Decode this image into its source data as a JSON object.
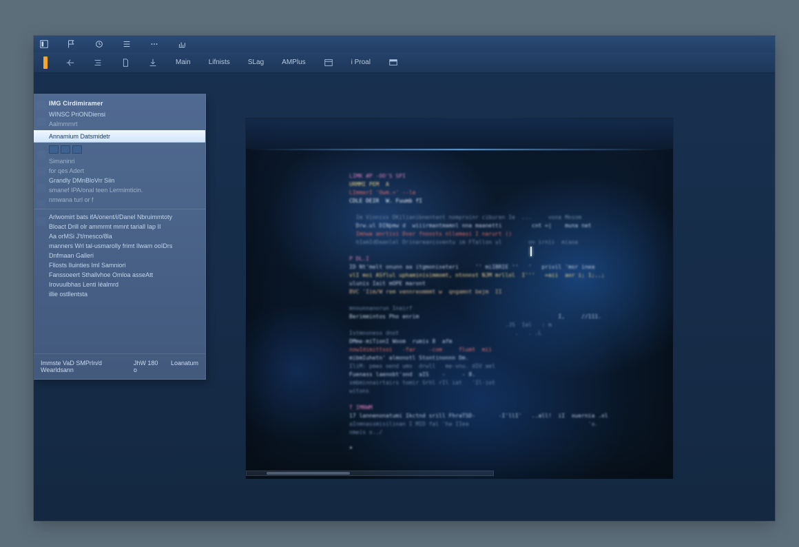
{
  "menu": {
    "items": [
      {
        "name": "app-menu-icon"
      },
      {
        "name": "flag-icon"
      },
      {
        "name": "history-icon"
      },
      {
        "name": "list-icon"
      },
      {
        "name": "more-icon"
      },
      {
        "name": "chart-icon"
      }
    ]
  },
  "toolbar": {
    "items": [
      {
        "label": "",
        "name": "orange-handle"
      },
      {
        "label": "",
        "name": "align-icon"
      },
      {
        "label": "",
        "name": "settings-icon"
      },
      {
        "label": "",
        "name": "file-icon"
      },
      {
        "label": "",
        "name": "download-icon"
      },
      {
        "label": "Main",
        "name": "tab-main"
      },
      {
        "label": "Lifnists",
        "name": "tab-lifnists"
      },
      {
        "label": "SLag",
        "name": "tab-slag"
      },
      {
        "label": "AMPlus",
        "name": "tab-amplus"
      },
      {
        "label": "",
        "name": "calendar-icon"
      },
      {
        "label": "i Proal",
        "name": "tab-iproal"
      },
      {
        "label": "",
        "name": "window-icon"
      }
    ]
  },
  "sidebar": {
    "heading1": "IMG   Cirdimiramer",
    "items": [
      {
        "label": "WINSC  PriONDiensi",
        "muted": false
      },
      {
        "label": "Aalmmrnrt",
        "muted": true
      },
      {
        "label": "Annamium Datsmidetr",
        "muted": false,
        "selected": true
      },
      {
        "label": "",
        "thumbs": true
      },
      {
        "label": "Simaninri",
        "muted": true
      },
      {
        "label": "for qes Adert",
        "muted": true
      },
      {
        "label": "Grandly DMnBloVrr Siin",
        "muted": false
      },
      {
        "label": "smanef IPA/onal teen Lermimticin.",
        "muted": true
      },
      {
        "label": "nmwana turl or f",
        "muted": true
      }
    ],
    "group2": [
      {
        "label": "Arlwomirt bats ifA/onent/i/Danel Nbruimmtoty"
      },
      {
        "label": "Bloact Drill olr ammrmt  mmnt tariall Iap II"
      },
      {
        "label": "Aa orMSi  J't/mesco/8la"
      },
      {
        "label": "manners Wrl tal-usmarolly frimt Ilwam ooIDrs"
      },
      {
        "label": "Dnfmaan Galleri"
      },
      {
        "label": "Fllosts Iluinties Iml Samniori"
      },
      {
        "label": "Fanssoeert Sthallvhoe Omloa asseAtt"
      },
      {
        "label": "Irovuulbhas Lenti Iéalmrd"
      },
      {
        "label": "illie  ostllentsta"
      }
    ],
    "footer_left": "Immste  VaD SMPrIn/d  Wearldsann",
    "footer_mid": "JhW 180 o",
    "footer_right": "Loanatum"
  },
  "code_lines": [
    {
      "t": "LIMK #P -OO'S SPI",
      "c": "kw"
    },
    {
      "t": "URMMI PEM  A",
      "c": "fn"
    },
    {
      "t": "LImmerI 'Owm.+' --la",
      "c": "err"
    },
    {
      "t": "CDLE DEIR  W. Fuumb fI",
      "c": "hi"
    },
    {
      "t": "",
      "c": ""
    },
    {
      "t": "  Im Vinniss DKilianibnentent nomproinr ciburen Ie  ...     vona Mnsom",
      "c": "cm"
    },
    {
      "t": "  Drw.ul DINpmw d  wiiirmantmamnl nna maanetti         cnt =|    muna net",
      "c": ""
    },
    {
      "t": "  Imnwa anrtisi Dver fnoosts nllemasi I narurt ()",
      "c": "err"
    },
    {
      "t": "  hIamIdDaanlel Drinareanisventu im FTallon ul        on irnii  miaoa",
      "c": "cm"
    },
    {
      "t": "",
      "c": ""
    },
    {
      "t": "P DL.I",
      "c": "kw"
    },
    {
      "t": "ID Nt'melt onunn aa itgmoniseteri     '' miIBRIE ''   '   privil 'mor inea",
      "c": ""
    },
    {
      "t": "vlI moi ASflul uphaminisimmomt, ntnnnst NJM mrllol  I'''   =aii  aor i; 1;..;",
      "c": "fn"
    },
    {
      "t": "ulunis Iait mOPE maront",
      "c": ""
    },
    {
      "t": "BVC 'Iim/W rem vennreommmt w  qngamnt bejm  II",
      "c": "str"
    },
    {
      "t": "",
      "c": ""
    },
    {
      "t": "mnounnanorun Inairf",
      "c": "cm"
    },
    {
      "t": "Berimmintos Pho enrim                                          I,     //111.",
      "c": ""
    },
    {
      "t": "                                               .JS  Ial   : m",
      "c": "cm"
    },
    {
      "t": "Istmnoneso dnot                                   .   . .L",
      "c": "cm"
    },
    {
      "t": "DMme-miTionI Woom  rumis 8  afm",
      "c": ""
    },
    {
      "t": "nowIdimittsoi   -far    -com     flumt  mii",
      "c": "err"
    },
    {
      "t": "mibmIuhetn' almonotl Stontinonnn Dm.",
      "c": ""
    },
    {
      "t": "IliM: pmeo oend umo  drwll   me-vnu. dIU ael",
      "c": "cm"
    },
    {
      "t": "Fuenass laenobt'ond  aIS    -     - 8.",
      "c": ""
    },
    {
      "t": "smbminnairtairs tomir Srhl rIl iat   'Il-iot",
      "c": "cm"
    },
    {
      "t": "witons",
      "c": "cm"
    },
    {
      "t": "",
      "c": ""
    },
    {
      "t": "T IMNWM",
      "c": "kw"
    },
    {
      "t": "17 lannenonatumi Ikctnd srill FhraTSD-       -I'llI'   ..all!  iI  ouernia .ol",
      "c": ""
    },
    {
      "t": "aInmnassmisilinan I MID fal 'ha IIea                                    'a.",
      "c": "cm"
    },
    {
      "t": "nmeis o../",
      "c": "cm"
    },
    {
      "t": "",
      "c": ""
    },
    {
      "t": "*",
      "c": "hi"
    }
  ]
}
